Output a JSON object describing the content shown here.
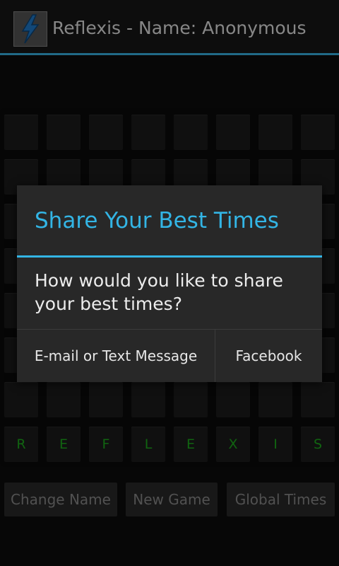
{
  "action_bar": {
    "title": "Reflexis - Name: Anonymous",
    "icon": "lightning-bolt-icon"
  },
  "board": {
    "letters": [
      "R",
      "E",
      "F",
      "L",
      "E",
      "X",
      "I",
      "S"
    ]
  },
  "bottom_buttons": {
    "change_name": "Change Name",
    "new_game": "New Game",
    "global_times": "Global Times"
  },
  "dialog": {
    "title": "Share Your Best Times",
    "message": "How would you like to share your best times?",
    "buttons": {
      "email": "E-mail or Text Message",
      "facebook": "Facebook"
    }
  },
  "colors": {
    "accent": "#33b5e5",
    "letter_green": "#1a9a1a"
  }
}
